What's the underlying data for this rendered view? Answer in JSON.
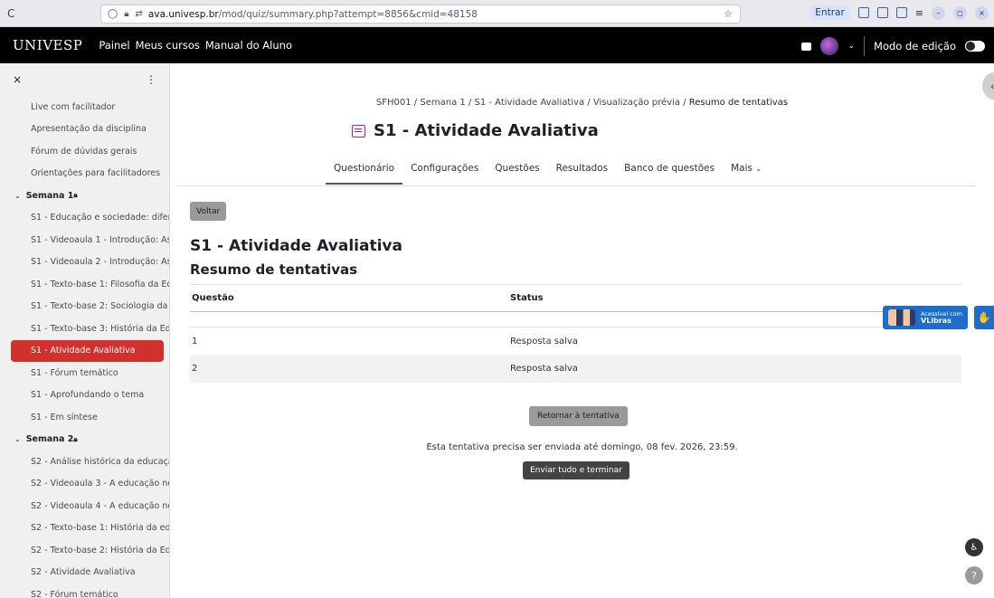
{
  "browser": {
    "reload": "C",
    "url_domain": "ava.univesp.br",
    "url_path": "/mod/quiz/summary.php?attempt=8856&cmid=48158",
    "entrar": "Entrar"
  },
  "nav": {
    "logo": "UNIVESP",
    "links": [
      "Painel",
      "Meus cursos",
      "Manual do Aluno"
    ],
    "edit_mode": "Modo de edição"
  },
  "sidebar": {
    "close": "×",
    "more": "⋮",
    "items": [
      {
        "label": "Live com facilitador",
        "type": "item"
      },
      {
        "label": "Apresentação da disciplina",
        "type": "item"
      },
      {
        "label": "Fórum de dúvidas gerais",
        "type": "item"
      },
      {
        "label": "Orientações para facilitadores",
        "type": "item"
      },
      {
        "label": "Semana 1",
        "type": "section"
      },
      {
        "label": "S1 - Educação e sociedade: difer...",
        "type": "item"
      },
      {
        "label": "S1 - Videoaula 1 - Introdução: As ...",
        "type": "item"
      },
      {
        "label": "S1 - Videoaula 2 - Introdução: As ...",
        "type": "item"
      },
      {
        "label": "S1 - Texto-base 1: Filosofia da Ed...",
        "type": "item"
      },
      {
        "label": "S1 - Texto-base 2: Sociologia da E...",
        "type": "item"
      },
      {
        "label": "S1 - Texto-base 3: História da Ed...",
        "type": "item"
      },
      {
        "label": "S1 - Atividade Avaliativa",
        "type": "active"
      },
      {
        "label": "S1 - Fórum temático",
        "type": "item"
      },
      {
        "label": "S1 - Aprofundando o tema",
        "type": "item"
      },
      {
        "label": "S1 - Em síntese",
        "type": "item"
      },
      {
        "label": "Semana 2",
        "type": "section"
      },
      {
        "label": "S2 - Análise histórica da educaçã...",
        "type": "item"
      },
      {
        "label": "S2 - Videoaula 3 - A educação no ...",
        "type": "item"
      },
      {
        "label": "S2 - Videoaula 4 - A educação no ...",
        "type": "item"
      },
      {
        "label": "S2 - Texto-base 1: História da ed...",
        "type": "item"
      },
      {
        "label": "S2 - Texto-base 2: História da Ed...",
        "type": "item"
      },
      {
        "label": "S2 - Atividade Avaliativa",
        "type": "item"
      },
      {
        "label": "S2 - Fórum temático",
        "type": "item"
      }
    ]
  },
  "breadcrumb": {
    "parts": [
      "SFH001",
      "Semana 1",
      "S1 - Atividade Avaliativa",
      "Visualização prévia"
    ],
    "current": "Resumo de tentativas"
  },
  "page": {
    "title": "S1 - Atividade Avaliativa",
    "tabs": [
      "Questionário",
      "Configurações",
      "Questões",
      "Resultados",
      "Banco de questões",
      "Mais"
    ],
    "back": "Voltar",
    "heading": "S1 - Atividade Avaliativa",
    "subheading": "Resumo de tentativas"
  },
  "table": {
    "headers": [
      "Questão",
      "Status"
    ],
    "rows": [
      {
        "q": "1",
        "status": "Resposta salva"
      },
      {
        "q": "2",
        "status": "Resposta salva"
      }
    ]
  },
  "actions": {
    "return": "Retornar à tentativa",
    "deadline": "Esta tentativa precisa ser enviada até domingo, 08 fev. 2026, 23:59.",
    "submit": "Enviar tudo e terminar"
  },
  "vlibras": {
    "line1": "Acessível com",
    "line2": "VLibras"
  }
}
